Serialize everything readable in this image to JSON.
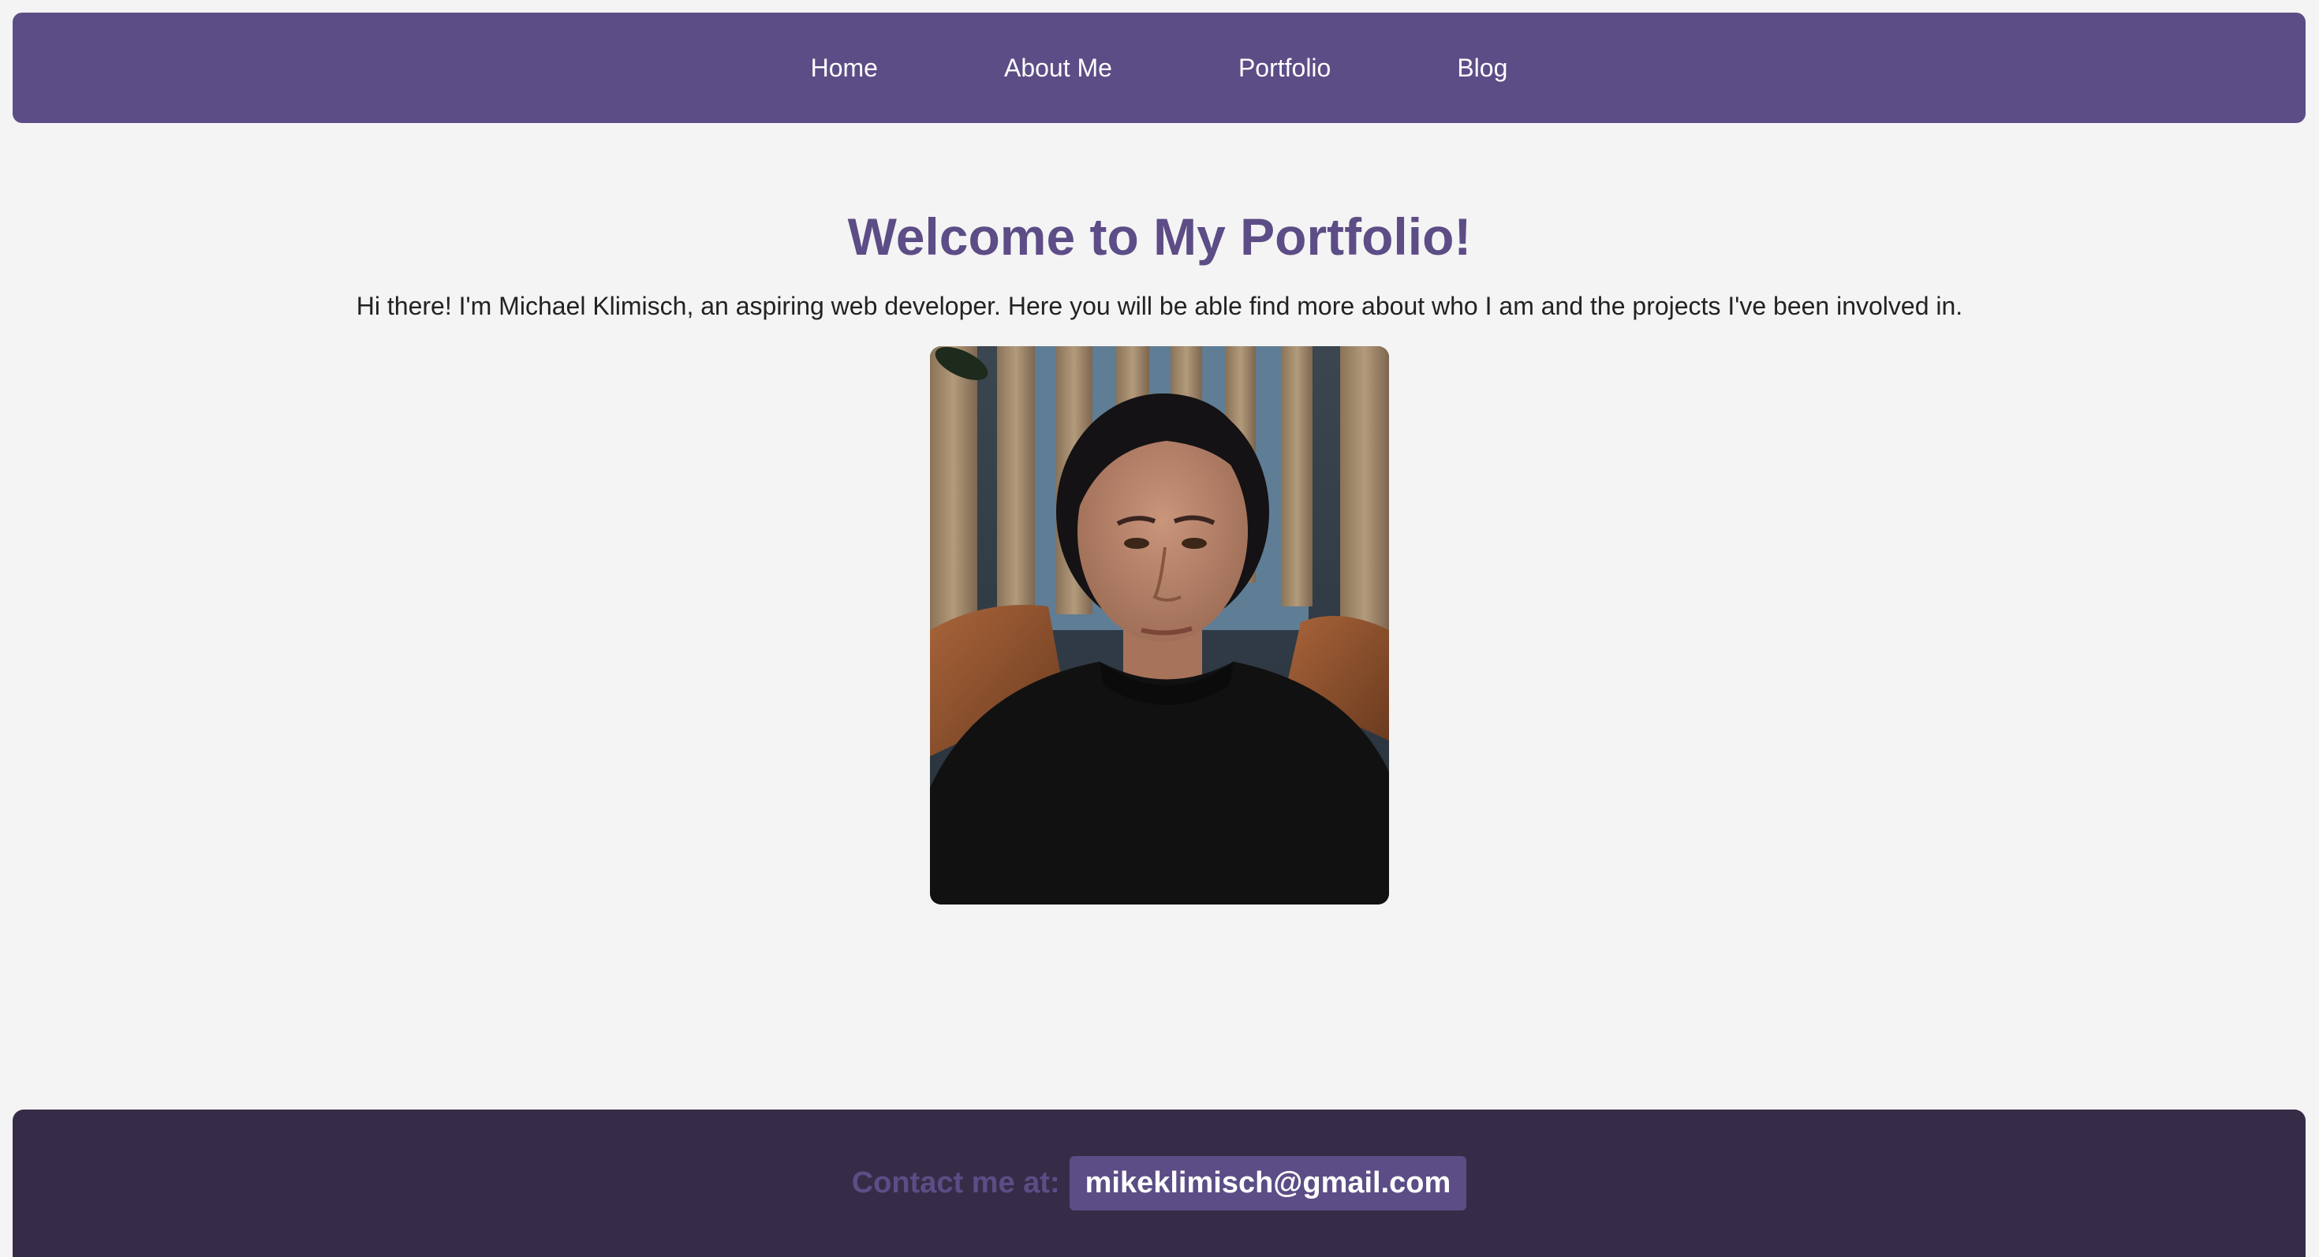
{
  "nav": {
    "items": [
      {
        "label": "Home"
      },
      {
        "label": "About Me"
      },
      {
        "label": "Portfolio"
      },
      {
        "label": "Blog"
      }
    ]
  },
  "hero": {
    "title": "Welcome to My Portfolio!",
    "intro": "Hi there! I'm Michael Klimisch, an aspiring web developer. Here you will be able find more about who I am and the projects I've been involved in."
  },
  "footer": {
    "contact_label": "Contact me at:",
    "email": "mikeklimisch@gmail.com"
  },
  "colors": {
    "accent": "#5c4d86",
    "footer_bg": "#372c47",
    "page_bg": "#f4f4f4"
  }
}
